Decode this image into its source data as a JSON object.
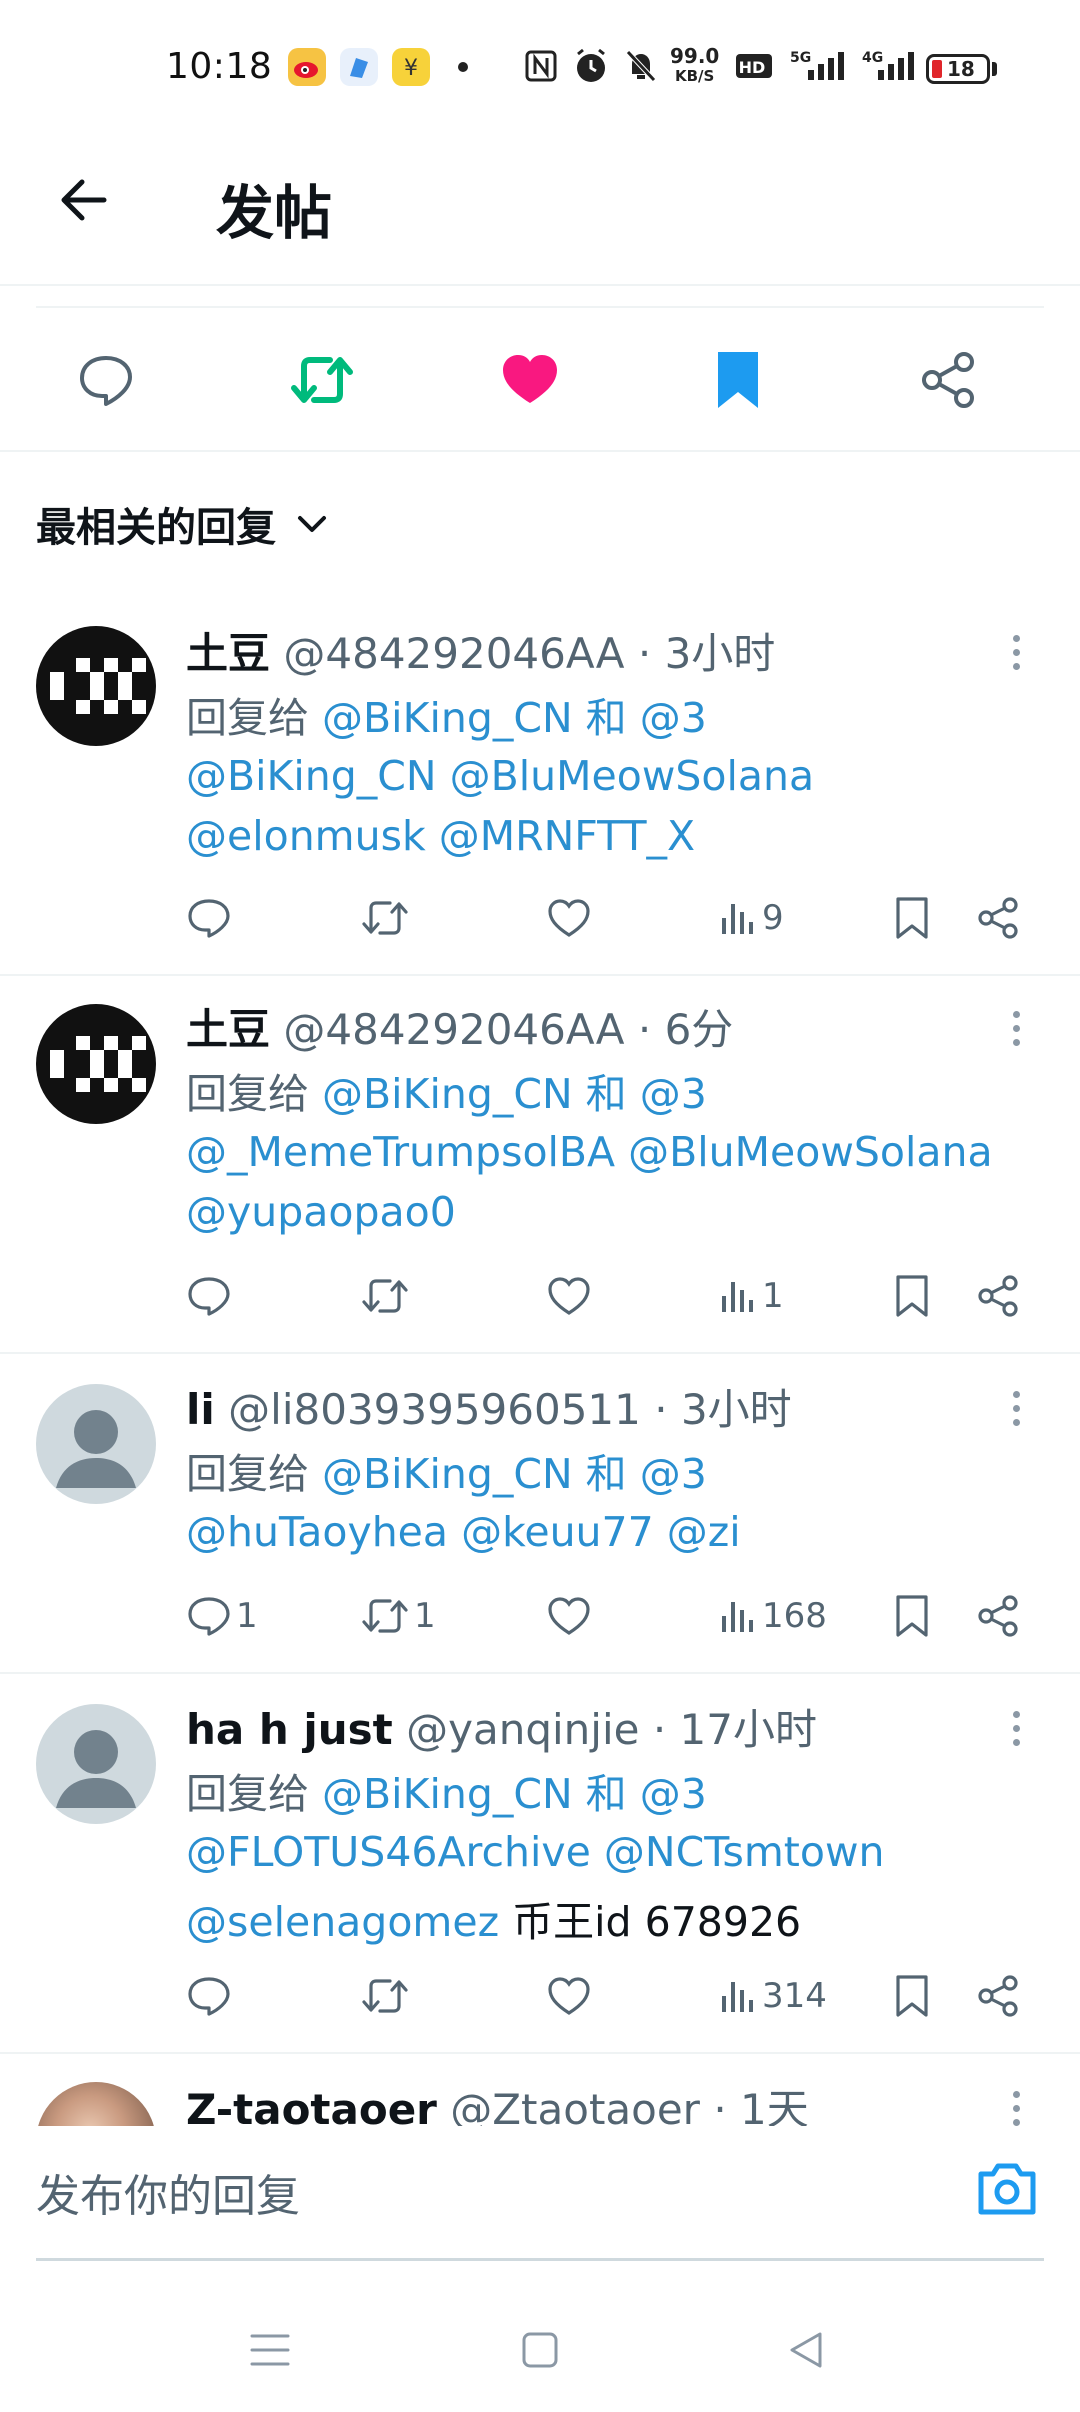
{
  "status_bar": {
    "time": "10:18",
    "net_speed_value": "99.0",
    "net_speed_unit": "KB/S",
    "battery": "18",
    "icons": [
      "weibo-icon",
      "app-icon",
      "wallet-icon",
      "nfc-icon",
      "alarm-icon",
      "mute-icon",
      "hd-icon",
      "signal-5g-icon",
      "signal-4g-icon",
      "battery-icon"
    ]
  },
  "header": {
    "title": "发帖"
  },
  "actions": [
    "reply-icon",
    "retweet-icon",
    "like-icon",
    "bookmark-icon",
    "share-icon"
  ],
  "colors": {
    "retweet": "#00ba7c",
    "like": "#f91880",
    "bookmark": "#1d9bf0",
    "mention": "#2a8fd0"
  },
  "sort": {
    "label": "最相关的回复"
  },
  "replies": [
    {
      "name": "土豆",
      "handle": "@484292046AA",
      "time": "· 3小时",
      "reply_prefix": "回复给",
      "reply_to": "@BiKing_CN 和 @3",
      "line2": "@BiKing_CN @BluMeowSolana",
      "line3": "@elonmusk @MRNFTT_X",
      "replies_count": "",
      "retweets_count": "",
      "views": "9"
    },
    {
      "name": "土豆",
      "handle": "@484292046AA",
      "time": "· 6分",
      "reply_prefix": "回复给",
      "reply_to": "@BiKing_CN 和 @3",
      "line2": "@_MemeTrumpsolBA @BluMeowSolana",
      "line3": "@yupaopao0",
      "replies_count": "",
      "retweets_count": "",
      "views": "1"
    },
    {
      "name": "li",
      "handle": "@li8039395960511",
      "time": "· 3小时",
      "reply_prefix": "回复给",
      "reply_to": "@BiKing_CN 和 @3",
      "line2": "@huTaoyhea @keuu77 @zi",
      "replies_count": "1",
      "retweets_count": "1",
      "views": "168"
    },
    {
      "name": "ha h just",
      "handle": "@yanqinjie",
      "time": "· 17小时",
      "reply_prefix": "回复给",
      "reply_to": "@BiKing_CN 和 @3",
      "line2": "@FLOTUS46Archive @NCTsmtown",
      "line3_mention": "@selenagomez",
      "line3_text": "币王id 678926",
      "replies_count": "",
      "retweets_count": "",
      "views": "314"
    },
    {
      "name": "Z-taotaoer",
      "handle": "@Ztaotaoer",
      "time": "· 1天"
    }
  ],
  "composer": {
    "placeholder": "发布你的回复"
  },
  "navbar": [
    "menu-icon",
    "home-icon",
    "back-triangle-icon"
  ]
}
